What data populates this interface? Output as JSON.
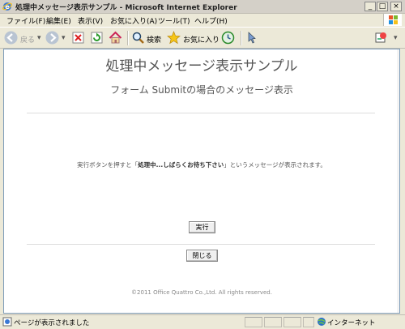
{
  "window": {
    "title": "処理中メッセージ表示サンプル - Microsoft Internet Explorer",
    "controls": [
      "_",
      "□",
      "×"
    ]
  },
  "menu": {
    "items": [
      "ファイル(F)",
      "編集(E)",
      "表示(V)",
      "お気に入り(A)",
      "ツール(T)",
      "ヘルプ(H)"
    ]
  },
  "toolbar": {
    "back_label": "戻る",
    "search_label": "検索",
    "favorites_label": "お気に入り"
  },
  "page": {
    "title": "処理中メッセージ表示サンプル",
    "subtitle": "フォーム Submitの場合のメッセージ表示",
    "description_before": "実行ボタンを押すと「",
    "description_bold": "処理中...しばらくお待ち下さい",
    "description_after": "」というメッセージが表示されます。",
    "execute_button": "実行",
    "close_button": "閉じる",
    "copyright": "©2011 Office Quattro Co.,Ltd. All rights reserved."
  },
  "status": {
    "text": "ページが表示されました",
    "zone": "インターネット"
  }
}
